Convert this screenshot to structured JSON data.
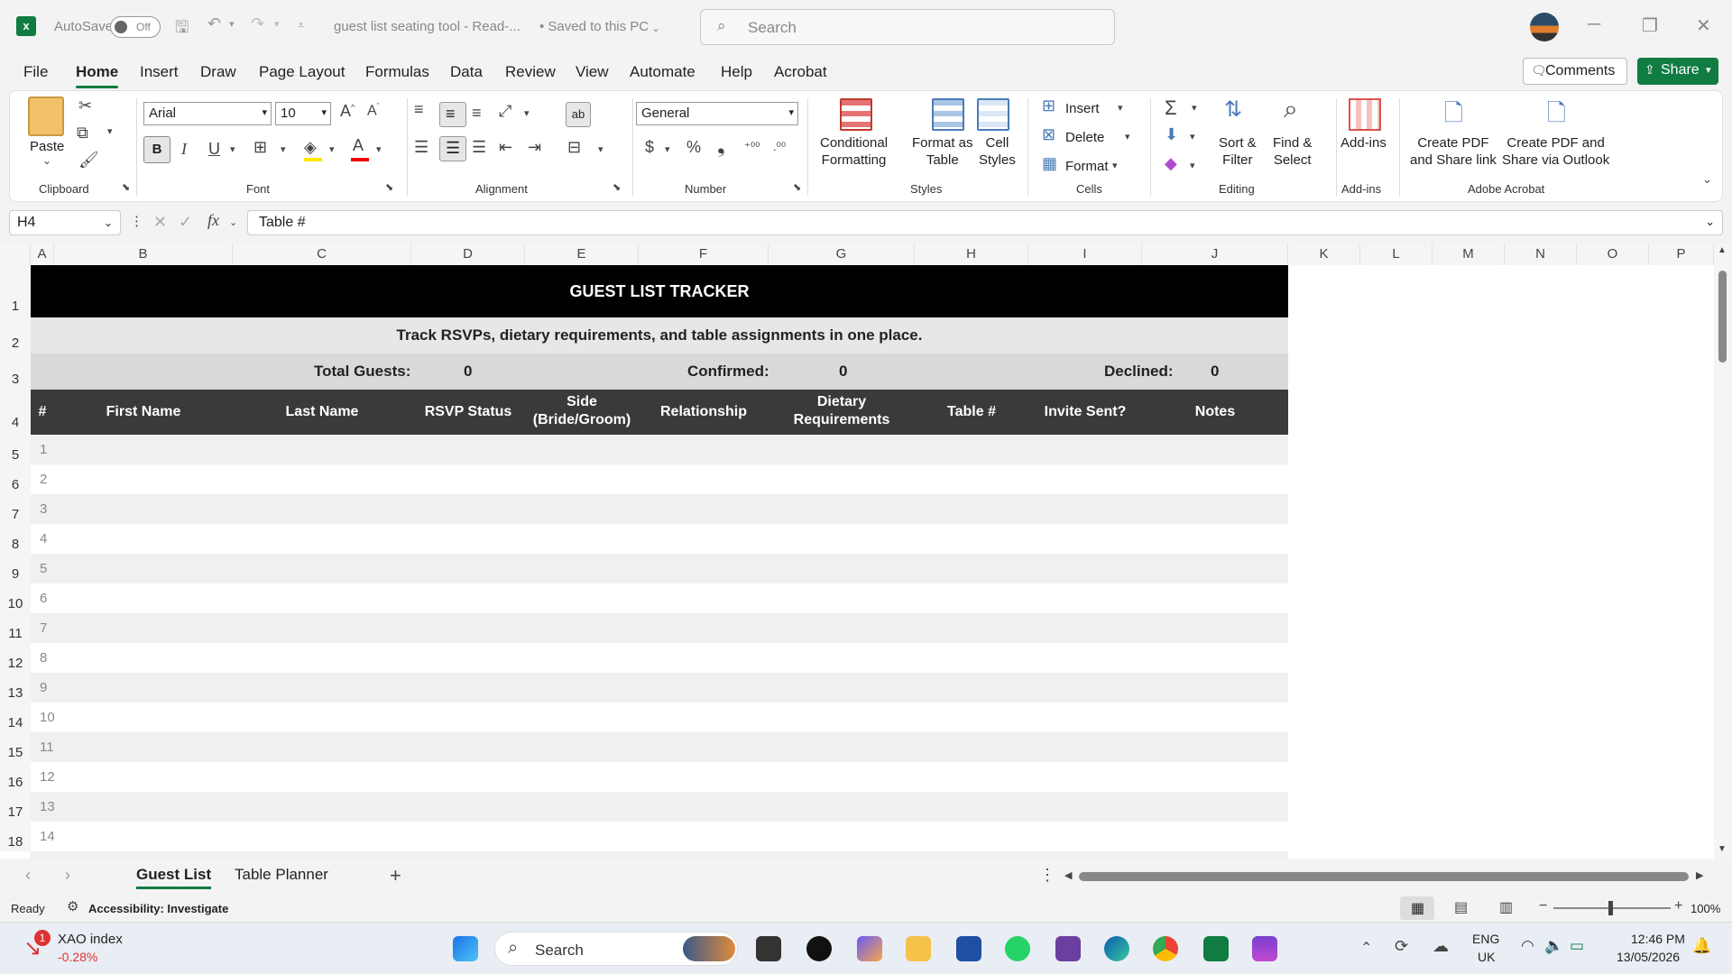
{
  "titlebar": {
    "autosave_label": "AutoSave",
    "autosave_state": "Off",
    "file_name": "guest list seating tool  -  Read-...",
    "save_status": "• Saved to this PC",
    "search_placeholder": "Search",
    "minimize": "─",
    "restore": "❐",
    "close": "✕"
  },
  "menu": {
    "tabs": [
      "File",
      "Home",
      "Insert",
      "Draw",
      "Page Layout",
      "Formulas",
      "Data",
      "Review",
      "View",
      "Automate",
      "Help",
      "Acrobat"
    ],
    "comments_label": "Comments",
    "share_label": "Share"
  },
  "ribbon": {
    "clipboard": {
      "paste": "Paste",
      "label": "Clipboard"
    },
    "font": {
      "name": "Arial",
      "size": "10",
      "label": "Font",
      "bold": "B",
      "italic": "I",
      "underline": "U"
    },
    "alignment": {
      "label": "Alignment"
    },
    "number": {
      "format": "General",
      "label": "Number",
      "currency": "$",
      "percent": "%",
      "comma": "❟"
    },
    "styles": {
      "conditional": "Conditional\nFormatting",
      "format_table": "Format as\nTable",
      "cell_styles": "Cell\nStyles",
      "label": "Styles"
    },
    "cells": {
      "insert": "Insert",
      "delete": "Delete",
      "format": "Format",
      "label": "Cells"
    },
    "editing": {
      "sort": "Sort &\nFilter",
      "find": "Find &\nSelect",
      "label": "Editing",
      "sum": "Σ"
    },
    "addins": {
      "addins": "Add-ins",
      "label": "Add-ins"
    },
    "acrobat": {
      "create_share": "Create PDF\nand Share link",
      "create_outlook": "Create PDF and\nShare via Outlook",
      "label": "Adobe Acrobat"
    }
  },
  "formula_bar": {
    "name_box": "H4",
    "fx": "fx",
    "content": "Table #"
  },
  "grid": {
    "columns": [
      "A",
      "B",
      "C",
      "D",
      "E",
      "F",
      "G",
      "H",
      "I",
      "J",
      "K",
      "L",
      "M",
      "N",
      "O",
      "P"
    ],
    "rows": [
      "1",
      "2",
      "3",
      "4",
      "5",
      "6",
      "7",
      "8",
      "9",
      "10",
      "11",
      "12",
      "13",
      "14",
      "15",
      "16",
      "17",
      "18"
    ],
    "title": "GUEST LIST TRACKER",
    "subtitle": "Track RSVPs, dietary requirements, and table assignments in one place.",
    "summary": {
      "total_label": "Total Guests:",
      "total_value": "0",
      "confirmed_label": "Confirmed:",
      "confirmed_value": "0",
      "declined_label": "Declined:",
      "declined_value": "0"
    },
    "headers": [
      "#",
      "First Name",
      "Last Name",
      "RSVP Status",
      "Side\n(Bride/Groom)",
      "Relationship",
      "Dietary\nRequirements",
      "Table #",
      "Invite Sent?",
      "Notes"
    ],
    "row_numbers": [
      "1",
      "2",
      "3",
      "4",
      "5",
      "6",
      "7",
      "8",
      "9",
      "10",
      "11",
      "12",
      "13",
      "14"
    ]
  },
  "sheets": {
    "tabs": [
      "Guest List",
      "Table Planner"
    ],
    "add": "+"
  },
  "status": {
    "ready": "Ready",
    "accessibility": "Accessibility: Investigate",
    "zoom": "100%"
  },
  "taskbar": {
    "stock_name": "XAO index",
    "stock_change": "-0.28%",
    "search": "Search",
    "lang": "ENG",
    "region": "UK",
    "time": "12:46 PM",
    "date": "13/05/2026",
    "badge": "1"
  }
}
